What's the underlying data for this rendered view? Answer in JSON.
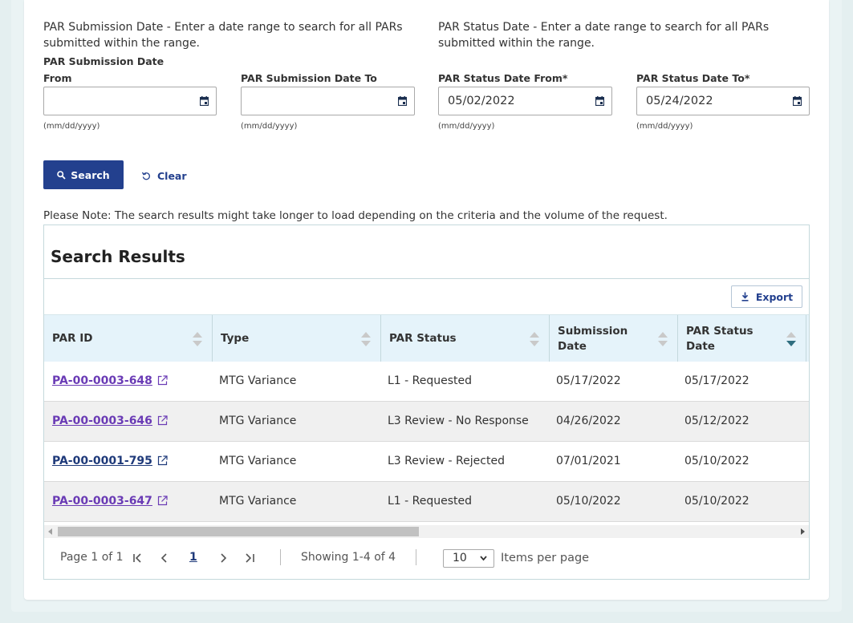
{
  "filters": {
    "submission_desc": "PAR Submission Date - Enter a date range to search for all PARs submitted within the range.",
    "status_desc": "PAR Status Date - Enter a date range to search for all PARs submitted within the range.",
    "submission_from": {
      "label_line1": "PAR Submission Date",
      "label_line2": "From",
      "value": "",
      "hint": "(mm/dd/yyyy)"
    },
    "submission_to": {
      "label": "PAR Submission Date To",
      "value": "",
      "hint": "(mm/dd/yyyy)"
    },
    "status_from": {
      "label": "PAR Status Date From*",
      "value": "05/02/2022",
      "hint": "(mm/dd/yyyy)"
    },
    "status_to": {
      "label": "PAR Status Date To*",
      "value": "05/24/2022",
      "hint": "(mm/dd/yyyy)"
    }
  },
  "actions": {
    "search_label": "Search",
    "clear_label": "Clear"
  },
  "note": "Please Note:  The search results might take longer to load depending on the criteria and the volume of the request.",
  "results": {
    "title": "Search Results",
    "export_label": "Export",
    "columns": [
      {
        "line1": "PAR ID",
        "line2": ""
      },
      {
        "line1": "Type",
        "line2": ""
      },
      {
        "line1": "PAR Status",
        "line2": ""
      },
      {
        "line1": "Submission",
        "line2": "Date"
      },
      {
        "line1": "PAR Status",
        "line2": "Date"
      }
    ],
    "sorted_column": "PAR Status Date",
    "sort_direction": "descending",
    "rows": [
      {
        "par_id": "PA-00-0003-648",
        "visited": true,
        "type": "MTG Variance",
        "status": "L1 - Requested",
        "submission_date": "05/17/2022",
        "status_date": "05/17/2022"
      },
      {
        "par_id": "PA-00-0003-646",
        "visited": true,
        "type": "MTG Variance",
        "status": "L3 Review - No Response",
        "submission_date": "04/26/2022",
        "status_date": "05/12/2022"
      },
      {
        "par_id": "PA-00-0001-795",
        "visited": false,
        "type": "MTG Variance",
        "status": "L3 Review - Rejected",
        "submission_date": "07/01/2021",
        "status_date": "05/10/2022"
      },
      {
        "par_id": "PA-00-0003-647",
        "visited": true,
        "type": "MTG Variance",
        "status": "L1 - Requested",
        "submission_date": "05/10/2022",
        "status_date": "05/10/2022"
      }
    ]
  },
  "pagination": {
    "page_info": "Page 1 of 1",
    "current_page": "1",
    "showing": "Showing 1-4 of 4",
    "page_size": "10",
    "items_per_page_label": "Items per page"
  },
  "colors": {
    "primary": "#23408e",
    "visited_link": "#6a3bb5",
    "link": "#1f3a7a",
    "header_bg": "#e5f3fa"
  }
}
